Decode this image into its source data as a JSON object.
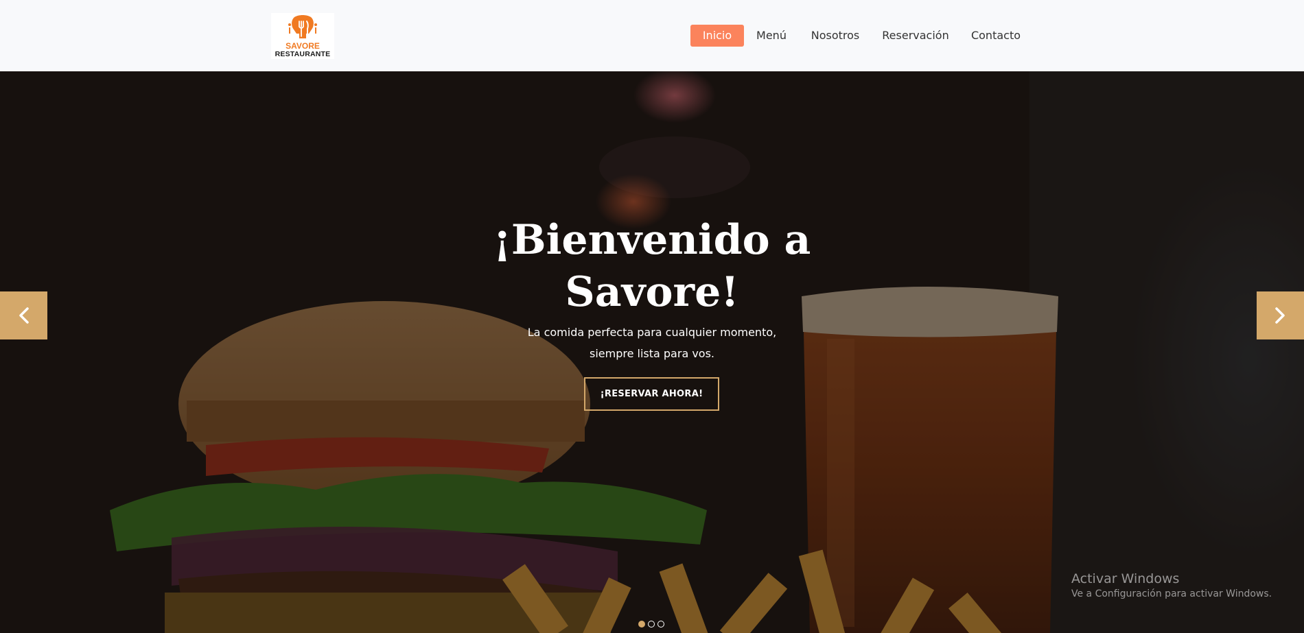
{
  "brand": {
    "name": "SAVORE",
    "subtitle": "RESTAURANTE",
    "accent_color": "#f07a22",
    "icon": "cutlery-icon"
  },
  "nav": {
    "items": [
      {
        "label": "Inicio",
        "active": true
      },
      {
        "label": "Menú",
        "active": false
      },
      {
        "label": "Nosotros",
        "active": false
      },
      {
        "label": "Reservación",
        "active": false
      },
      {
        "label": "Contacto",
        "active": false
      }
    ],
    "active_color": "#fb835c"
  },
  "hero": {
    "title_line1": "¡Bienvenido a",
    "title_line2": "Savore!",
    "subtitle_line1": "La comida perfecta para cualquier momento,",
    "subtitle_line2": "siempre lista para vos.",
    "cta_label": "¡RESERVAR AHORA!",
    "accent_color": "#d4a86a",
    "prev_icon": "chevron-left-icon",
    "next_icon": "chevron-right-icon",
    "slides": {
      "count": 3,
      "active": 1
    }
  },
  "watermark": {
    "title": "Activar Windows",
    "subtitle": "Ve a Configuración para activar Windows."
  }
}
